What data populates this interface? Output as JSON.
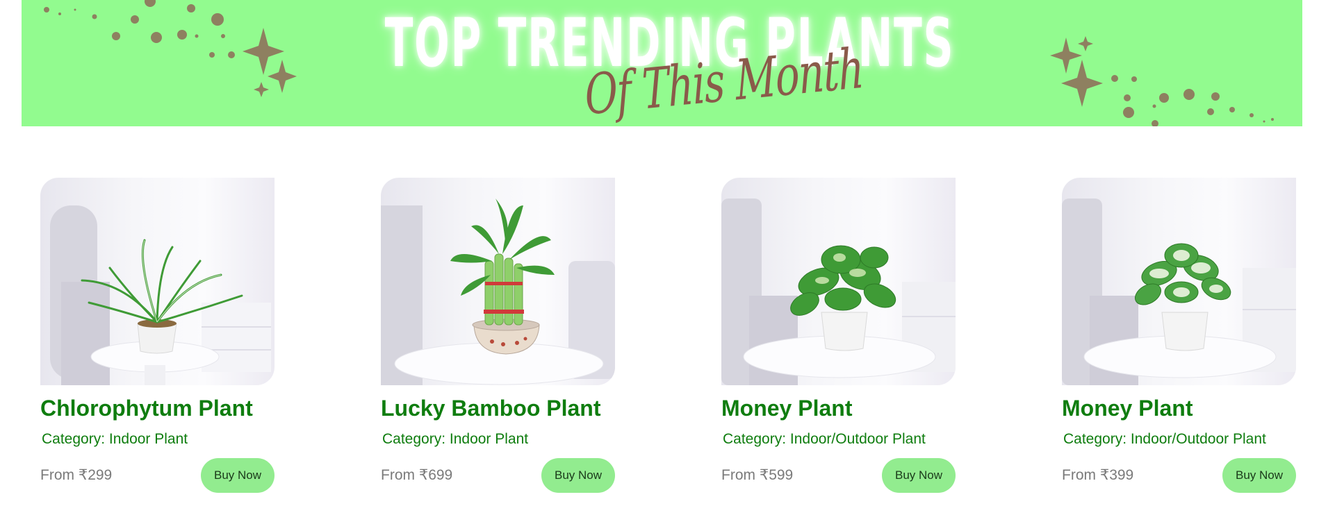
{
  "banner": {
    "title": "TOP TRENDING PLANTS",
    "subtitle": "Of This Month",
    "background_color": "#92fb8f",
    "decoration_color": "#8e8060"
  },
  "products": [
    {
      "name": "Chlorophytum Plant",
      "category": "Category: Indoor Plant",
      "price": "From ₹299",
      "button": "Buy Now",
      "image": "chlorophytum-plant-image"
    },
    {
      "name": "Lucky Bamboo Plant",
      "category": "Category: Indoor Plant",
      "price": "From ₹699",
      "button": "Buy Now",
      "image": "lucky-bamboo-plant-image"
    },
    {
      "name": "Money Plant",
      "category": "Category: Indoor/Outdoor Plant",
      "price": "From ₹599",
      "button": "Buy Now",
      "image": "money-plant-image"
    },
    {
      "name": "Money Plant",
      "category": "Category: Indoor/Outdoor Plant",
      "price": "From ₹399",
      "button": "Buy Now",
      "image": "money-plant-variegated-image"
    }
  ],
  "colors": {
    "title_green": "#0f7d0f",
    "button_green": "#92ec8f",
    "price_gray": "#7a7a7a"
  }
}
